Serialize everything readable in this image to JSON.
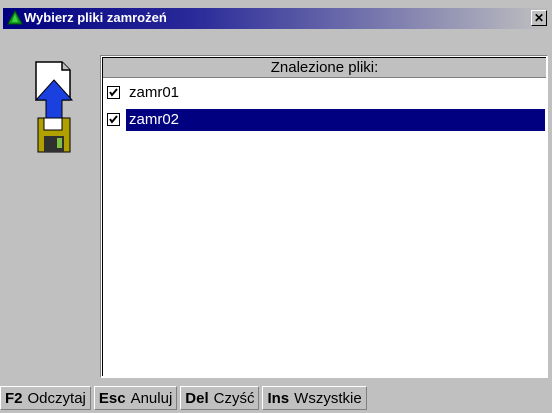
{
  "window": {
    "title": "Wybierz pliki zamrożeń",
    "close_symbol": "✕"
  },
  "list": {
    "header": "Znalezione pliki:",
    "items": [
      {
        "label": "zamr01",
        "checked": true,
        "selected": false
      },
      {
        "label": "zamr02",
        "checked": true,
        "selected": true
      }
    ]
  },
  "fkeys": [
    {
      "key": "F2",
      "label": "Odczytaj"
    },
    {
      "key": "Esc",
      "label": "Anuluj"
    },
    {
      "key": "Del",
      "label": "Czyść"
    },
    {
      "key": "Ins",
      "label": "Wszystkie"
    }
  ],
  "icons": {
    "title": "green-triangle-icon",
    "sidebar": "load-file-from-disk-icon"
  },
  "colors": {
    "selection": "#000080",
    "face": "#c0c0c0"
  }
}
